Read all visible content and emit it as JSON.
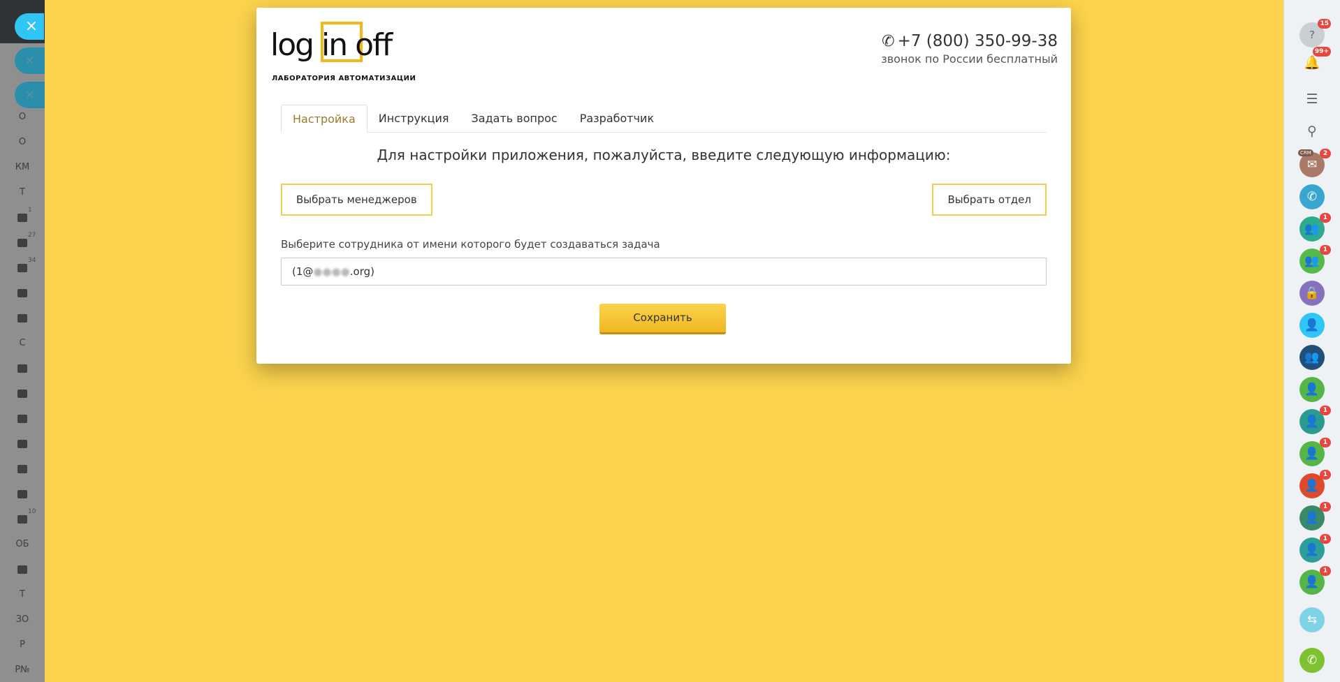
{
  "left_sidebar": {
    "close_icon": "×",
    "items": [
      {
        "kind": "text",
        "label": "О"
      },
      {
        "kind": "text",
        "label": "О"
      },
      {
        "kind": "text",
        "label": "КМ"
      },
      {
        "kind": "text",
        "label": "Т"
      },
      {
        "kind": "icon",
        "icon": "feed-icon",
        "count": "1"
      },
      {
        "kind": "icon",
        "icon": "tasks-icon",
        "count": "27"
      },
      {
        "kind": "icon",
        "icon": "chat-icon",
        "count": "34"
      },
      {
        "kind": "icon",
        "icon": "group-icon",
        "count": ""
      },
      {
        "kind": "icon",
        "icon": "drive-icon",
        "count": ""
      },
      {
        "kind": "text",
        "label": "С"
      },
      {
        "kind": "icon",
        "icon": "calendar-icon",
        "count": ""
      },
      {
        "kind": "icon",
        "icon": "clock-icon",
        "count": ""
      },
      {
        "kind": "icon",
        "icon": "mail-icon",
        "count": ""
      },
      {
        "kind": "icon",
        "icon": "robot-icon",
        "count": ""
      },
      {
        "kind": "icon",
        "icon": "window-icon",
        "count": ""
      },
      {
        "kind": "icon",
        "icon": "contact-card-icon",
        "count": ""
      },
      {
        "kind": "icon",
        "icon": "cart-icon",
        "count": "10"
      },
      {
        "kind": "text",
        "label": "ОБ"
      },
      {
        "kind": "icon",
        "icon": "document-icon",
        "count": ""
      },
      {
        "kind": "text",
        "label": "Т"
      },
      {
        "kind": "text",
        "label": "ЗО"
      },
      {
        "kind": "text",
        "label": "Р"
      },
      {
        "kind": "text",
        "label": "Р№"
      }
    ]
  },
  "right_sidebar": {
    "items": [
      {
        "icon": "help-icon",
        "glyph": "?",
        "style": "grey",
        "color": "",
        "badge": "15"
      },
      {
        "icon": "notifications-icon",
        "glyph": "🔔",
        "style": "plain",
        "color": "",
        "badge": "99+"
      },
      {
        "icon": "chat-list-icon",
        "glyph": "☰",
        "style": "plain",
        "color": "",
        "badge": ""
      },
      {
        "icon": "search-icon",
        "glyph": "⚲",
        "style": "plain",
        "color": "",
        "badge": ""
      },
      {
        "icon": "crm-icon",
        "glyph": "✉",
        "style": "color",
        "color": "#a87a67",
        "badge": "2",
        "tag": "CRM"
      },
      {
        "icon": "call-icon",
        "glyph": "✆",
        "style": "color",
        "color": "#3ba5d1",
        "badge": ""
      },
      {
        "icon": "group-chat-icon",
        "glyph": "👥",
        "style": "color",
        "color": "#2eaa8f",
        "badge": "1"
      },
      {
        "icon": "group-chat-icon",
        "glyph": "👥",
        "style": "color",
        "color": "#57b84b",
        "badge": "1"
      },
      {
        "icon": "lock-icon",
        "glyph": "🔒",
        "style": "color",
        "color": "#8771bd",
        "badge": ""
      },
      {
        "icon": "user-clock-icon",
        "glyph": "👤",
        "style": "color",
        "color": "#2fc6f6",
        "badge": ""
      },
      {
        "icon": "open-lines-icon",
        "glyph": "👥",
        "style": "color",
        "color": "#20507a",
        "badge": ""
      },
      {
        "icon": "user-icon",
        "glyph": "👤",
        "style": "color",
        "color": "#56b548",
        "badge": ""
      },
      {
        "icon": "user-icon",
        "glyph": "👤",
        "style": "color",
        "color": "#2a9b8e",
        "badge": "1"
      },
      {
        "icon": "user-icon",
        "glyph": "👤",
        "style": "color",
        "color": "#56b548",
        "badge": "1"
      },
      {
        "icon": "user-icon",
        "glyph": "👤",
        "style": "color",
        "color": "#dd4a2c",
        "badge": "1"
      },
      {
        "icon": "user-icon",
        "glyph": "👤",
        "style": "color",
        "color": "#3a8a6a",
        "badge": "1"
      },
      {
        "icon": "user-icon",
        "glyph": "👤",
        "style": "color",
        "color": "#2b9f98",
        "badge": "1"
      },
      {
        "icon": "user-icon",
        "glyph": "👤",
        "style": "color",
        "color": "#56b548",
        "badge": "1"
      },
      {
        "icon": "device-icon",
        "glyph": "⇆",
        "style": "color",
        "color": "#7fd3e6",
        "badge": ""
      },
      {
        "icon": "phone-icon",
        "glyph": "✆",
        "style": "color",
        "color": "#7fc231",
        "badge": ""
      }
    ]
  },
  "modal": {
    "logo": {
      "text": "log in off",
      "subtitle": "ЛАБОРАТОРИЯ АВТОМАТИЗАЦИИ"
    },
    "contact": {
      "phone_icon": "✆",
      "phone": "+7 (800) 350-99-38",
      "note": "звонок по России бесплатный"
    },
    "tabs": [
      {
        "label": "Настройка",
        "active": true
      },
      {
        "label": "Инструкция",
        "active": false
      },
      {
        "label": "Задать вопрос",
        "active": false
      },
      {
        "label": "Разработчик",
        "active": false
      }
    ],
    "heading": "Для настройки приложения, пожалуйста, введите следующую информацию:",
    "select_managers_label": "Выбрать менеджеров",
    "select_department_label": "Выбрать отдел",
    "employee_label": "Выберите сотрудника от имени которого будет создаваться задача",
    "employee_value_prefix": "(1@",
    "employee_value_masked": "●●●●",
    "employee_value_suffix": ".org)",
    "save_label": "Сохранить"
  },
  "colors": {
    "page_background": "#fbd34c",
    "accent": "#f4b716",
    "active_tab": "#9c7a2c",
    "badge": "#e8473d",
    "close_button": "#2fc6f6"
  }
}
